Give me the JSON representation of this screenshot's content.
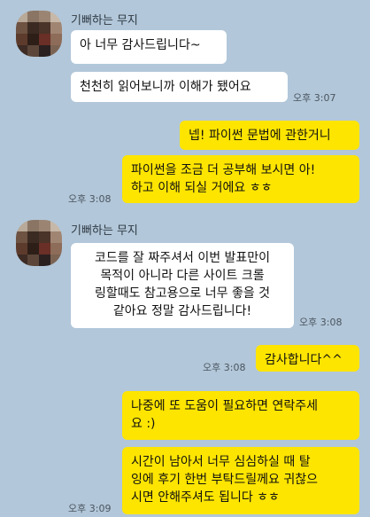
{
  "colors": {
    "background": "#b2c7d9",
    "incoming": "#ffffff",
    "outgoing": "#fee500"
  },
  "groups": [
    {
      "sender": "기뻐하는 무지",
      "messages": [
        {
          "text": "아 너무 감사드립니다~",
          "time": ""
        },
        {
          "text": "천천히 읽어보니까 이해가 됐어요",
          "time": "오후 3:07"
        }
      ]
    },
    {
      "messages": [
        {
          "text": "넵! 파이썬 문법에 관한거니",
          "time": ""
        },
        {
          "text": "파이썬을 조금 더 공부해 보시면 아!\n하고 이해 되실 거에요 ㅎㅎ",
          "time": "오후 3:08"
        }
      ]
    },
    {
      "sender": "기뻐하는 무지",
      "messages": [
        {
          "text": "코드를 잘 짜주셔서 이번 발표만이\n목적이 아니라 다른 사이트 크롤\n링할때도 참고용으로 너무 좋을 것\n같아요 정말 감사드립니다!",
          "time": "오후 3:08"
        }
      ]
    },
    {
      "messages": [
        {
          "text": "감사합니다^^",
          "time": "오후 3:08"
        },
        {
          "text": "나중에 또 도움이 필요하면 연락주세\n요 :)",
          "time": ""
        },
        {
          "text": "시간이 남아서 너무 심심하실 때 탈\n잉에 후기 한번 부탁드릴께요 귀찮으\n시면 안해주셔도 됩니다 ㅎㅎ",
          "time": "오후 3:09"
        }
      ]
    }
  ]
}
